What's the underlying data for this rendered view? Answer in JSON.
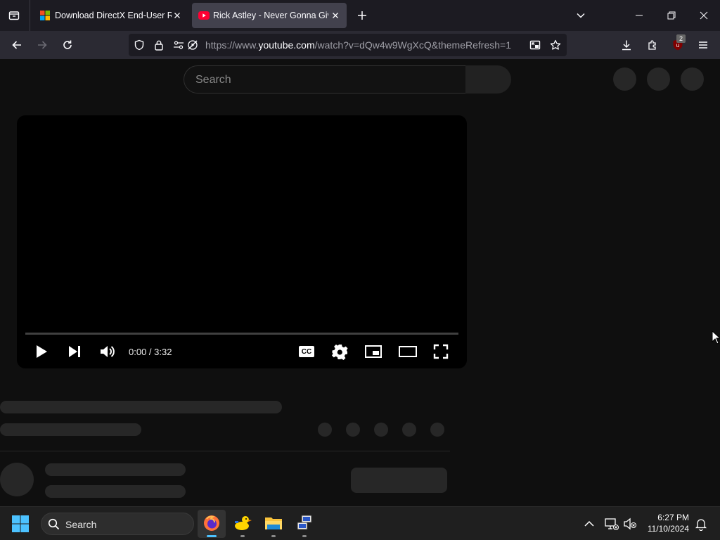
{
  "browser": {
    "tabs": [
      {
        "title": "Download DirectX End-User Ru",
        "favicon": "microsoft-logo",
        "active": false
      },
      {
        "title": "Rick Astley - Never Gonna Give",
        "favicon": "youtube-logo",
        "active": true
      }
    ],
    "url": {
      "prefix": "https://www.",
      "domain": "youtube.com",
      "path": "/watch?v=dQw4w9WgXcQ&themeRefresh=1"
    },
    "extension_badge": "2"
  },
  "youtube": {
    "search_placeholder": "Search",
    "player": {
      "time_display": "0:00 / 3:32",
      "progress": 0,
      "cc_label": "CC"
    }
  },
  "taskbar": {
    "search_label": "Search",
    "clock_time": "6:27 PM",
    "clock_date": "11/10/2024",
    "apps": [
      "firefox-icon",
      "duck-app-icon",
      "file-explorer-icon",
      "network-tool-icon"
    ]
  },
  "colors": {
    "accent": "#4cc2ff",
    "youtube_red": "#ff0033",
    "tab_active": "#42414d",
    "page_bg": "#0f0f0f",
    "skeleton": "#272727"
  }
}
